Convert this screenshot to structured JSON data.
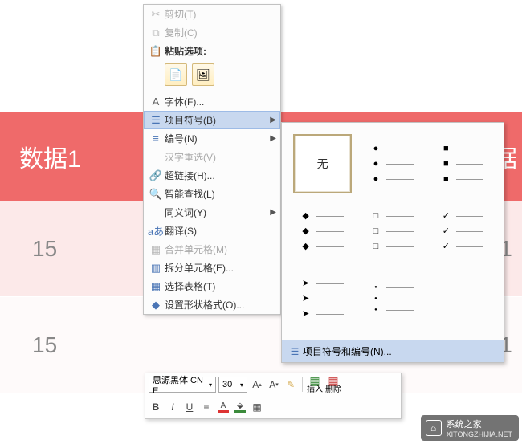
{
  "table": {
    "header": {
      "col1": "数据1",
      "col_right": "数据"
    },
    "rows": [
      {
        "c1": "15",
        "c4": "1"
      },
      {
        "c1": "15",
        "c4": "1"
      }
    ]
  },
  "context_menu": {
    "cut": "剪切(T)",
    "copy": "复制(C)",
    "paste_options_label": "粘贴选项:",
    "font": "字体(F)...",
    "bullets": "项目符号(B)",
    "numbering": "编号(N)",
    "hanzi": "汉字重选(V)",
    "hyperlink": "超链接(H)...",
    "lookup": "智能查找(L)",
    "synonym": "同义词(Y)",
    "translate": "翻译(S)",
    "merge": "合并单元格(M)",
    "split": "拆分单元格(E)...",
    "select_table": "选择表格(T)",
    "shape_format": "设置形状格式(O)..."
  },
  "bullet_panel": {
    "none": "无",
    "footer": "项目符号和编号(N)..."
  },
  "mini_toolbar": {
    "font_name": "思源黑体 CN E",
    "font_size": "30",
    "insert_label": "插入",
    "delete_label": "删除"
  },
  "watermark": {
    "title": "系统之家",
    "url": "XITONGZHIJIA.NET"
  }
}
